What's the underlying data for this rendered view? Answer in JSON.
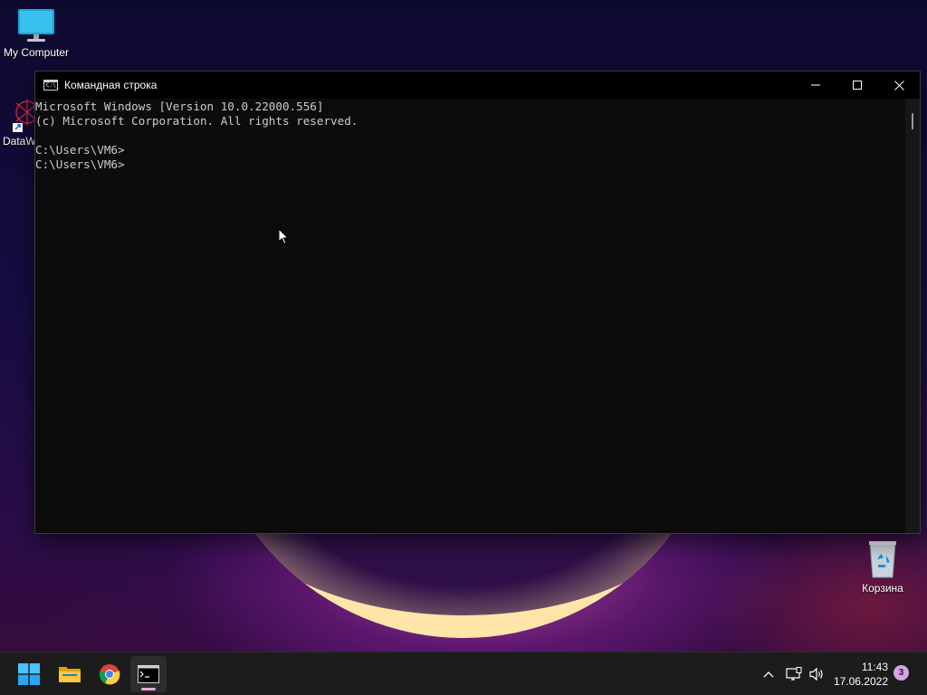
{
  "desktop": {
    "icons": [
      {
        "label": "My Computer"
      },
      {
        "label": "DataW"
      },
      {
        "label": "Корзина"
      }
    ]
  },
  "window": {
    "title": "Командная строка",
    "title_icon_text": "C:\\_",
    "console_lines": [
      "Microsoft Windows [Version 10.0.22000.556]",
      "(c) Microsoft Corporation. All rights reserved.",
      "",
      "C:\\Users\\VM6>",
      "C:\\Users\\VM6>"
    ]
  },
  "taskbar": {
    "apps": [
      "start-icon",
      "file-explorer-icon",
      "chrome-icon",
      "terminal-icon"
    ],
    "active_app": "terminal-icon",
    "accent": "#e8a7d8"
  },
  "tray": {
    "time": "11:43",
    "date": "17.06.2022",
    "notifications": "3"
  }
}
